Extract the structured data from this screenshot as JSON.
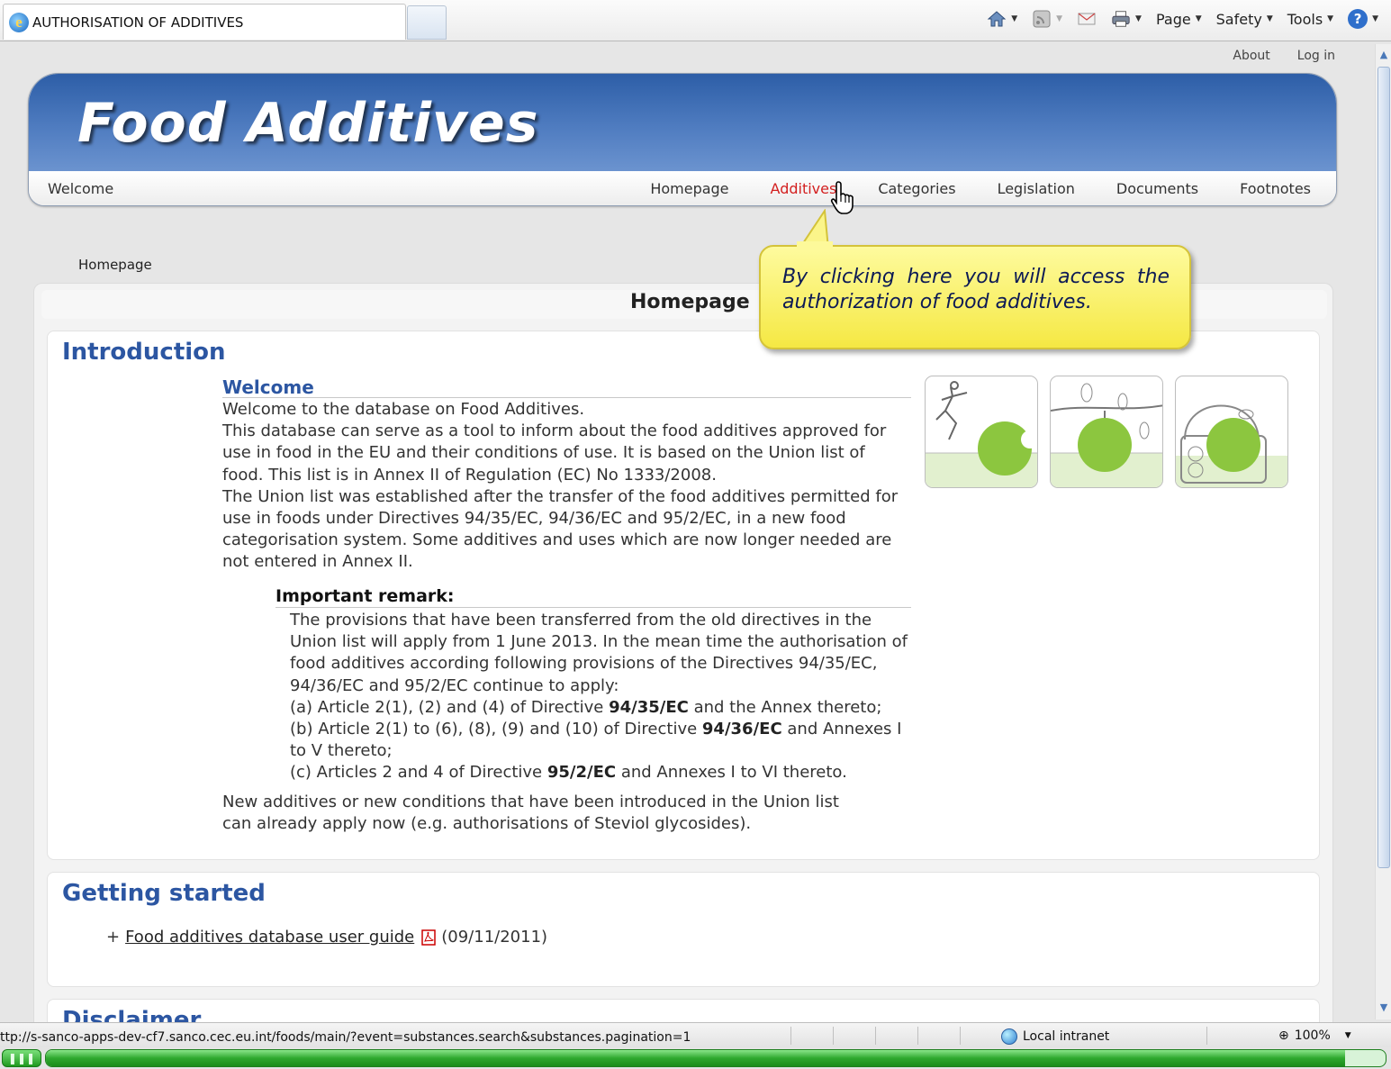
{
  "browser": {
    "tab_title": "AUTHORISATION OF ADDITIVES",
    "menu": {
      "page": "Page",
      "safety": "Safety",
      "tools": "Tools"
    },
    "status_url": "ttp://s-sanco-apps-dev-cf7.sanco.cec.eu.int/foods/main/?event=substances.search&substances.pagination=1",
    "zone": "Local intranet",
    "zoom": "100%",
    "load_progress": 0.97
  },
  "site": {
    "top_links": {
      "about": "About",
      "login": "Log in"
    },
    "title": "Food Additives",
    "welcome": "Welcome",
    "nav": [
      "Homepage",
      "Additives",
      "Categories",
      "Legislation",
      "Documents",
      "Footnotes"
    ],
    "active_nav": "Additives"
  },
  "breadcrumb": "Homepage",
  "callout": "By clicking here you will access the authorization of food additives.",
  "page_heading": "Homepage",
  "introduction": {
    "title": "Introduction",
    "welcome_heading": "Welcome",
    "paragraphs": [
      "Welcome to the database on Food Additives.",
      "This database can serve as a tool to inform about the food additives approved for use in food in the EU and their conditions of use. It is based on the Union list of food. This list is in Annex II of Regulation (EC) No 1333/2008.",
      "The Union list was established after the transfer of the food additives permitted for use in foods under Directives 94/35/EC, 94/36/EC and 95/2/EC, in a new food categorisation system. Some additives and uses which are now longer needed are not entered in Annex II."
    ],
    "remark_heading": "Important remark:",
    "remark_intro": "The provisions that have been transferred from the old directives in the Union list will apply from 1 June 2013. In the mean time the authorisation of food additives according following provisions of the Directives 94/35/EC, 94/36/EC and 95/2/EC continue to apply:",
    "remark_items": [
      {
        "pre": "(a) Article 2(1), (2) and (4) of Directive ",
        "bold": "94/35/EC",
        "post": " and the Annex thereto;"
      },
      {
        "pre": "(b) Article 2(1) to (6), (8), (9) and (10) of Directive ",
        "bold": "94/36/EC",
        "post": " and Annexes I to V thereto;"
      },
      {
        "pre": "(c) Articles 2 and 4 of Directive ",
        "bold": "95/2/EC",
        "post": " and Annexes I to VI thereto."
      }
    ],
    "closing": "New additives or new conditions that have been introduced in the Union list can already apply now (e.g. authorisations of Steviol glycosides)."
  },
  "getting_started": {
    "title": "Getting started",
    "bullet": "+",
    "link": "Food additives database user guide",
    "date": "(09/11/2011)"
  },
  "disclaimer": {
    "title": "Disclaimer"
  },
  "colors": {
    "banner": "#4f7cc0",
    "heading": "#2c56a2",
    "active_nav": "#d32020",
    "callout": "#f5e843",
    "apple": "#8cc63f"
  },
  "icons": [
    "home-icon",
    "feeds-icon",
    "mail-icon",
    "print-icon",
    "help-icon",
    "globe-icon",
    "pdf-icon",
    "hand-cursor-icon"
  ]
}
